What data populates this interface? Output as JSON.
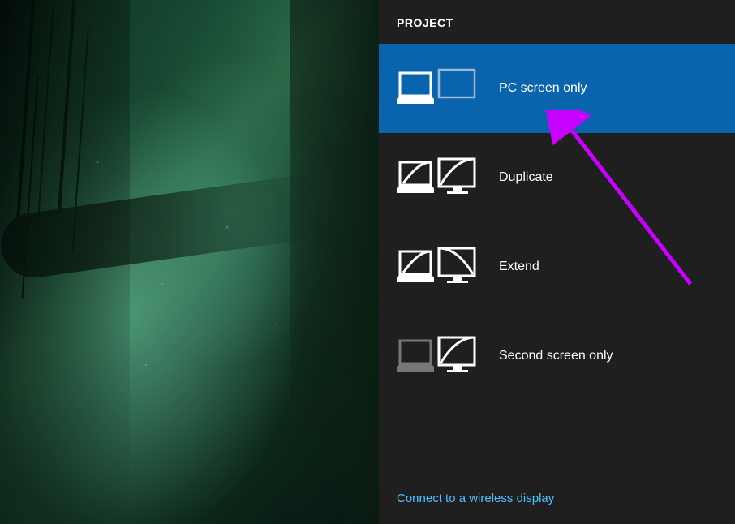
{
  "panel": {
    "title": "PROJECT",
    "options": [
      {
        "label": "PC screen only"
      },
      {
        "label": "Duplicate"
      },
      {
        "label": "Extend"
      },
      {
        "label": "Second screen only"
      }
    ],
    "wireless_link": "Connect to a wireless display"
  }
}
